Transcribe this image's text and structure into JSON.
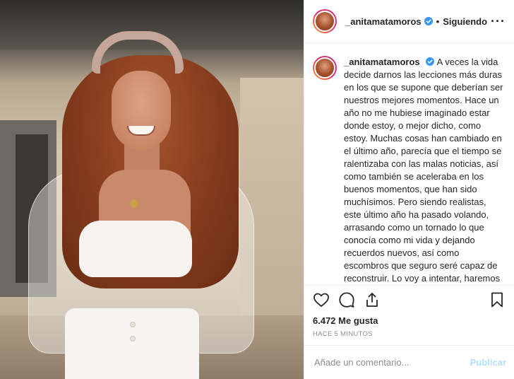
{
  "post": {
    "username": "_anitamatamoros",
    "follow_state": "Siguiendo",
    "more_label": "···",
    "caption": "A veces la vida decide darnos las lecciones más duras en los que se supone que deberían ser nuestros mejores momentos. Hace un año no me hubiese imaginado estar donde estoy, o mejor dicho, como estoy. Muchas cosas han cambiado en el último año, parecía que el tiempo se ralentizaba con las malas noticias, así como también se aceleraba en los buenos momentos, que han sido muchísimos. Pero siendo realistas, este último año ha pasado volando, arrasando como un tornado lo que conocía como mi vida y dejando recuerdos nuevos, así como escombros que seguro seré capaz de reconstruir. Lo voy a intentar, haremos lo que mejor sabemos hacer, ser fuertes, estar unidos y seguir",
    "likes": "6.472 Me gusta",
    "time": "HACE 5 MINUTOS"
  },
  "comment": {
    "placeholder": "Añade un comentario...",
    "publish_label": "Publicar"
  },
  "icons": {
    "verified": "verified-badge-icon",
    "like": "heart-icon",
    "comment": "speech-bubble-icon",
    "share": "share-icon",
    "save": "bookmark-icon"
  },
  "colors": {
    "verified": "#3897f0",
    "publish_disabled": "#b2dffc",
    "muted": "#8e8e8e"
  }
}
